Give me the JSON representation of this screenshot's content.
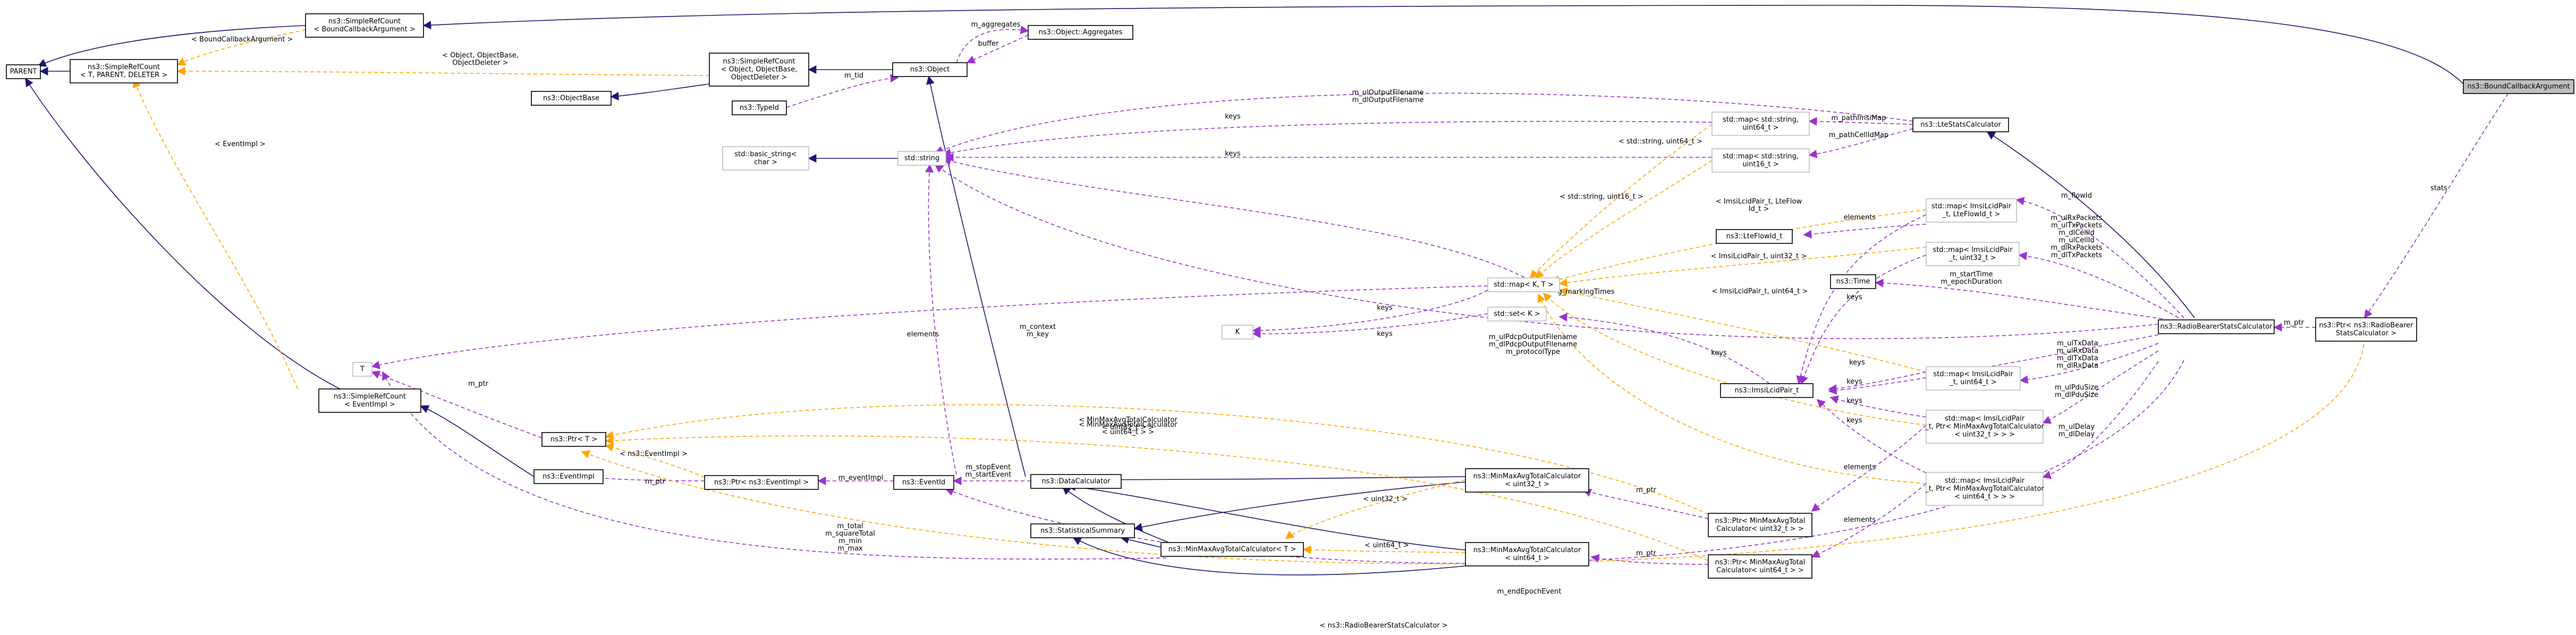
{
  "nodes": {
    "n_parent": [
      "PARENT"
    ],
    "n_src_bcb": [
      "ns3::SimpleRefCount",
      "< BoundCallbackArgument >"
    ],
    "n_src_tpd": [
      "ns3::SimpleRefCount",
      "< T, PARENT, DELETER >"
    ],
    "n_src_obj": [
      "ns3::SimpleRefCount",
      "< Object, ObjectBase,",
      "ObjectDeleter >"
    ],
    "n_objectbase": [
      "ns3::ObjectBase"
    ],
    "n_typeid": [
      "ns3::TypeId"
    ],
    "n_object": [
      "ns3::Object"
    ],
    "n_aggregates": [
      "ns3::Object::Aggregates"
    ],
    "n_basic_string": [
      "std::basic_string<",
      "char >"
    ],
    "n_string": [
      "std::string"
    ],
    "n_t": [
      "T"
    ],
    "n_src_ev": [
      "ns3::SimpleRefCount",
      "< EventImpl >"
    ],
    "n_ptr_t": [
      "ns3::Ptr< T >"
    ],
    "n_eventimpl": [
      "ns3::EventImpl"
    ],
    "n_ptr_evimpl": [
      "ns3::Ptr< ns3::EventImpl >"
    ],
    "n_eventid": [
      "ns3::EventId"
    ],
    "n_datacalc": [
      "ns3::DataCalculator"
    ],
    "n_statsum": [
      "ns3::StatisticalSummary"
    ],
    "n_minmax_t": [
      "ns3::MinMaxAvgTotalCalculator< T >"
    ],
    "n_minmax_32": [
      "ns3::MinMaxAvgTotalCalculator",
      "< uint32_t >"
    ],
    "n_minmax_64": [
      "ns3::MinMaxAvgTotalCalculator",
      "< uint64_t >"
    ],
    "n_k": [
      "K"
    ],
    "n_map_kt": [
      "std::map< K, T >"
    ],
    "n_set_k": [
      "std::set< K >"
    ],
    "n_map_str64": [
      "std::map< std::string,",
      "uint64_t >"
    ],
    "n_map_str16": [
      "std::map< std::string,",
      "uint16_t >"
    ],
    "n_ltestats": [
      "ns3::LteStatsCalculator"
    ],
    "n_lteflowid": [
      "ns3::LteFlowId_t"
    ],
    "n_map_imsi_flow": [
      "std::map< ImsiLcidPair",
      "_t, LteFlowId_t >"
    ],
    "n_map_imsi_32": [
      "std::map< ImsiLcidPair",
      "_t, uint32_t >"
    ],
    "n_time": [
      "ns3::Time"
    ],
    "n_imsilcid": [
      "ns3::ImsiLcidPair_t"
    ],
    "n_map_imsi_64": [
      "std::map< ImsiLcidPair",
      "_t, uint64_t >"
    ],
    "n_map_imsi_ptr32": [
      "std::map< ImsiLcidPair",
      "_t, Ptr< MinMaxAvgTotalCalculator",
      "< uint32_t > > >"
    ],
    "n_map_imsi_ptr64": [
      "std::map< ImsiLcidPair",
      "_t, Ptr< MinMaxAvgTotalCalculator",
      "< uint64_t > > >"
    ],
    "n_ptr_minmax32": [
      "ns3::Ptr< MinMaxAvgTotal",
      "Calculator< uint32_t > >"
    ],
    "n_ptr_minmax64": [
      "ns3::Ptr< MinMaxAvgTotal",
      "Calculator< uint64_t > >"
    ],
    "n_rbstats": [
      "ns3::RadioBearerStatsCalculator"
    ],
    "n_ptr_rbstats": [
      "ns3::Ptr< ns3::RadioBearer",
      "StatsCalculator >"
    ],
    "n_boundcb": [
      "ns3::BoundCallbackArgument"
    ]
  },
  "edge_labels": {
    "l_bcb_arg": [
      "< BoundCallbackArgument >"
    ],
    "l_obj_args": [
      "< Object, ObjectBase,",
      "ObjectDeleter >"
    ],
    "l_eventimpl": [
      "< EventImpl >"
    ],
    "l_m_tid": [
      "m_tid"
    ],
    "l_m_aggregates": [
      "m_aggregates"
    ],
    "l_buffer": [
      "buffer"
    ],
    "l_keys_1": [
      "keys"
    ],
    "l_keys_2": [
      "keys"
    ],
    "l_out_filenames": [
      "m_ulOutputFilename",
      "m_dlOutputFilename"
    ],
    "l_pathimsimap": [
      "m_pathImsiMap"
    ],
    "l_pathcellidmap": [
      "m_pathCellIdMap"
    ],
    "l_str_u64": [
      "< std::string, uint64_t >"
    ],
    "l_str_u16": [
      "< std::string, uint16_t >"
    ],
    "l_imsi_flow": [
      "< ImsiLcidPair_t, LteFlow",
      "Id_t >"
    ],
    "l_imsi_u32": [
      "< ImsiLcidPair_t, uint32_t >"
    ],
    "l_imsi_u64": [
      "< ImsiLcidPair_t, uint64_t >"
    ],
    "l_elements_flow": [
      "elements"
    ],
    "l_elements_t": [
      "elements"
    ],
    "l_keys_mapkt": [
      "keys"
    ],
    "l_keys_setk": [
      "keys"
    ],
    "l_marking": [
      "g_markingTimes"
    ],
    "l_pdcp": [
      "m_ulPdcpOutputFilename",
      "m_dlPdcpOutputFilename",
      "m_protocolType"
    ],
    "l_context": [
      "m_context",
      "m_key"
    ],
    "l_m_ptr_t": [
      "m_ptr"
    ],
    "l_impl_ptr": [
      "< ns3::EventImpl >"
    ],
    "l_m_ptr_ev": [
      "m_ptr"
    ],
    "l_m_eventimpl": [
      "m_eventImpl"
    ],
    "l_stopevent": [
      "m_stopEvent",
      "m_startEvent"
    ],
    "l_minmax32_ptr": [
      "< MinMaxAvgTotalCalculator",
      "< uint32_t > >"
    ],
    "l_minmax64_ptr": [
      "< MinMaxAvgTotalCalculator",
      "< uint64_t > >"
    ],
    "l_u32": [
      "< uint32_t >"
    ],
    "l_u64": [
      "< uint64_t >"
    ],
    "l_totals": [
      "m_total",
      "m_squareTotal",
      "m_min",
      "m_max"
    ],
    "l_m_ptr_32": [
      "m_ptr"
    ],
    "l_m_ptr_64": [
      "m_ptr"
    ],
    "l_endepoch": [
      "m_endEpochEvent"
    ],
    "l_rbstats_ptr": [
      "< ns3::RadioBearerStatsCalculator >"
    ],
    "l_flowid": [
      "m_flowId"
    ],
    "l_packets": [
      "m_ulRxPackets",
      "m_ulTxPackets",
      "m_dlCellId",
      "m_ulCellId",
      "m_dlRxPackets",
      "m_dlTxPackets"
    ],
    "l_starttime": [
      "m_startTime",
      "m_epochDuration"
    ],
    "l_txdata": [
      "m_ulTxData",
      "m_ulRxData",
      "m_dlTxData",
      "m_dlRxData"
    ],
    "l_pdusize": [
      "m_ulPduSize",
      "m_dlPduSize"
    ],
    "l_delay": [
      "m_ulDelay",
      "m_dlDelay"
    ],
    "l_m_ptr_rb": [
      "m_ptr"
    ],
    "l_stats": [
      "stats"
    ],
    "l_keys_imsi_flow": [
      "keys"
    ],
    "l_keys_imsi_32": [
      "keys"
    ],
    "l_keys_imsi_64": [
      "keys"
    ],
    "l_keys_imsi_ptr32": [
      "keys"
    ],
    "l_keys_imsi_ptr64": [
      "keys"
    ],
    "l_elements_32": [
      "elements"
    ],
    "l_elements_64": [
      "elements"
    ],
    "l_keys_imsilcid": [
      "keys"
    ]
  },
  "legend": {
    "inheritance_color": "#191970",
    "usage_color": "#9a32cd",
    "template_color": "#ffa500",
    "highlight_fill": "#bfbfbf",
    "undocumented_border": "#bfbfbf"
  }
}
